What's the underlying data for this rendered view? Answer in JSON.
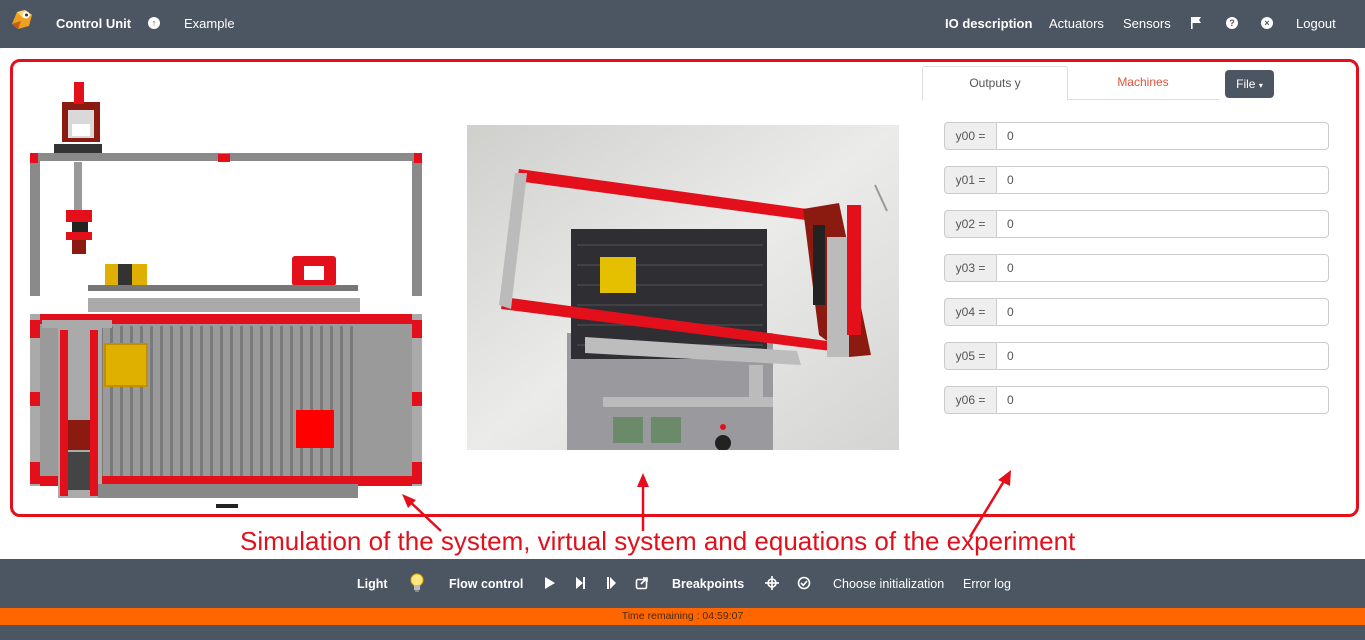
{
  "nav": {
    "brand": "Control Unit",
    "project": "Example",
    "links": [
      "IO description",
      "Actuators",
      "Sensors",
      "Logout"
    ],
    "icons": [
      "logo-icon",
      "up-circle-icon",
      "flag-icon",
      "question-icon",
      "close-circle-icon"
    ]
  },
  "tabs": {
    "outputs_label": "Outputs y",
    "machines_label": "Machines",
    "file_label": "File"
  },
  "outputs": [
    {
      "label": "y00 =",
      "value": "0"
    },
    {
      "label": "y01 =",
      "value": "0"
    },
    {
      "label": "y02 =",
      "value": "0"
    },
    {
      "label": "y03 =",
      "value": "0"
    },
    {
      "label": "y04 =",
      "value": "0"
    },
    {
      "label": "y05 =",
      "value": "0"
    },
    {
      "label": "y06 =",
      "value": "0"
    }
  ],
  "annotation": {
    "caption": "Simulation of the system, virtual system and equations of the experiment",
    "color": "#e3101c"
  },
  "toolbar": {
    "light_label": "Light",
    "flow_label": "Flow control",
    "breakpoints_label": "Breakpoints",
    "init_label": "Choose initialization",
    "errorlog_label": "Error log",
    "icons": [
      "bulb-icon",
      "play-icon",
      "step-icon",
      "step-end-icon",
      "share-icon",
      "crosshair-icon",
      "check-circle-icon"
    ]
  },
  "status": {
    "text": "Time remaining : 04:59:07",
    "color": "#ff6600"
  },
  "colors": {
    "navbar": "#4c5562",
    "accent_red": "#e3101c",
    "tab_machines": "#e0533a"
  }
}
